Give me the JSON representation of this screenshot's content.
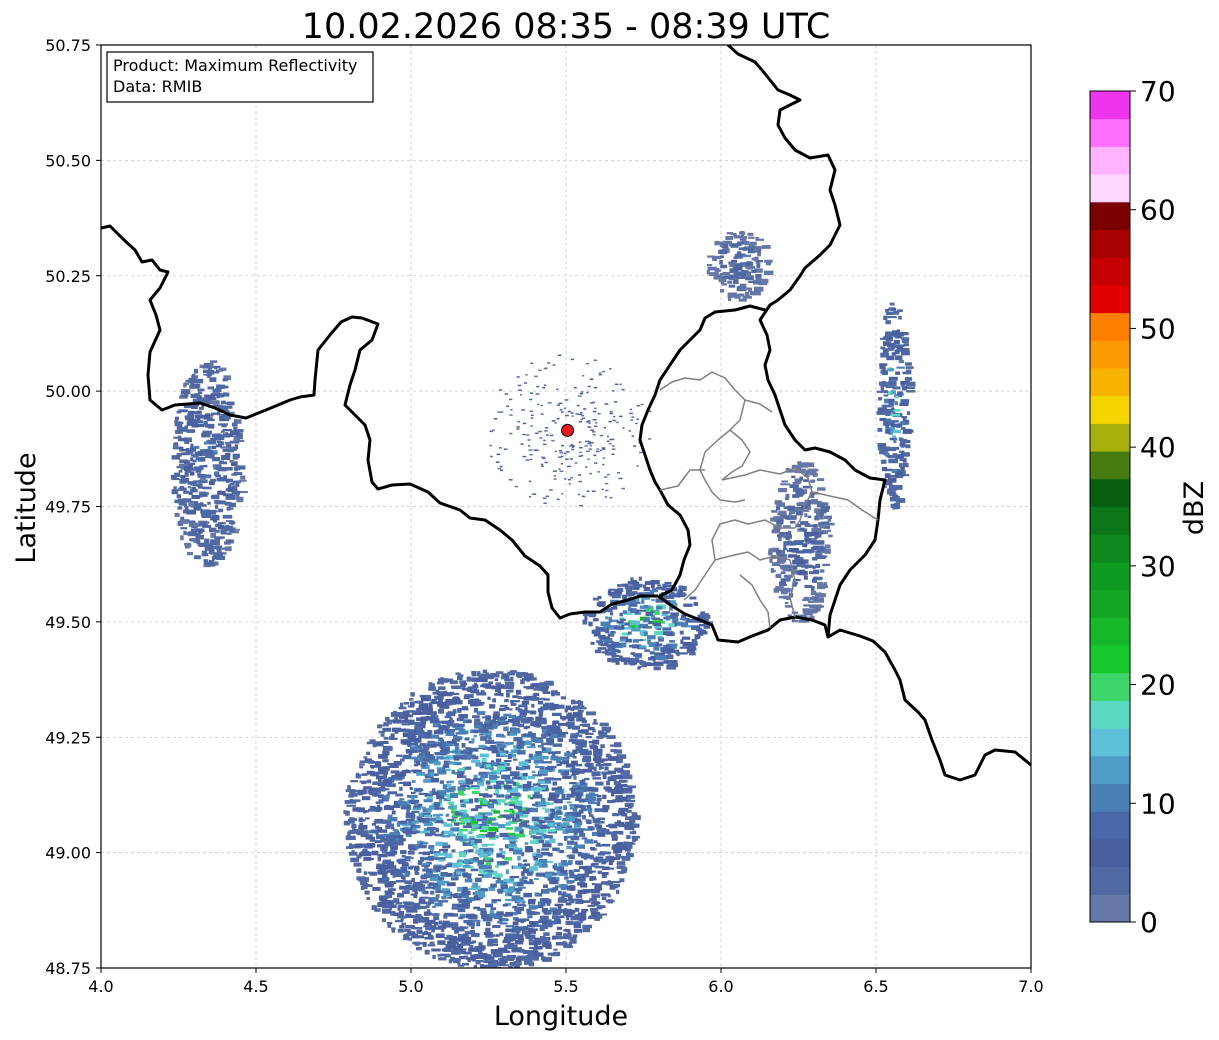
{
  "title": "10.02.2026 08:35 - 08:39 UTC",
  "info": {
    "product_line": "Product: Maximum Reflectivity",
    "data_line": "Data: RMIB"
  },
  "axes": {
    "xlabel": "Longitude",
    "ylabel": "Latitude",
    "xlim": [
      4.0,
      7.0
    ],
    "ylim": [
      48.75,
      50.75
    ],
    "xticks": [
      "4.0",
      "4.5",
      "5.0",
      "5.5",
      "6.0",
      "6.5",
      "7.0"
    ],
    "yticks": [
      "48.75",
      "49.00",
      "49.25",
      "49.50",
      "49.75",
      "50.00",
      "50.25",
      "50.50",
      "50.75"
    ],
    "grid": true
  },
  "colorbar": {
    "label": "dBZ",
    "ticks": [
      "0",
      "10",
      "20",
      "30",
      "40",
      "50",
      "60",
      "70"
    ],
    "range": [
      0,
      70
    ],
    "step": 2.5,
    "colors": [
      "#6577a6",
      "#5069a3",
      "#4a5fa0",
      "#4a68a8",
      "#4a80b5",
      "#4f9cc6",
      "#5ebfd8",
      "#5ad8c1",
      "#3ed66a",
      "#17c92d",
      "#16b82a",
      "#13a623",
      "#0f9a20",
      "#0e871d",
      "#0c7517",
      "#065e10",
      "#457b10",
      "#a8b00e",
      "#f5d600",
      "#f8b200",
      "#fb9a00",
      "#fc7f00",
      "#e00000",
      "#c40000",
      "#a60000",
      "#7b0000",
      "#ffd8ff",
      "#ffb2ff",
      "#ff6fff",
      "#ee35ee"
    ]
  },
  "radar": {
    "name": "radar-site",
    "lon": 5.505,
    "lat": 49.915,
    "color": "#e41a1c"
  },
  "chart_data": {
    "type": "heatmap",
    "title": "10.02.2026 08:35 - 08:39 UTC",
    "xlabel": "Longitude",
    "ylabel": "Latitude",
    "xlim": [
      4.0,
      7.0
    ],
    "ylim": [
      48.75,
      50.75
    ],
    "value_label": "dBZ",
    "value_range": [
      0,
      70
    ],
    "echo_areas": [
      {
        "lon": [
          4.78,
          5.72
        ],
        "lat": [
          48.75,
          49.4
        ],
        "max_dBZ": 28
      },
      {
        "lon": [
          4.22,
          4.45
        ],
        "lat": [
          49.62,
          50.07
        ],
        "max_dBZ": 15
      },
      {
        "lon": [
          5.55,
          5.95
        ],
        "lat": [
          49.4,
          49.6
        ],
        "max_dBZ": 30
      },
      {
        "lon": [
          6.5,
          6.6
        ],
        "lat": [
          49.75,
          50.2
        ],
        "max_dBZ": 24
      },
      {
        "lon": [
          6.15,
          6.35
        ],
        "lat": [
          49.5,
          49.85
        ],
        "max_dBZ": 10
      },
      {
        "lon": [
          5.95,
          6.15
        ],
        "lat": [
          50.2,
          50.35
        ],
        "max_dBZ": 8
      }
    ]
  }
}
